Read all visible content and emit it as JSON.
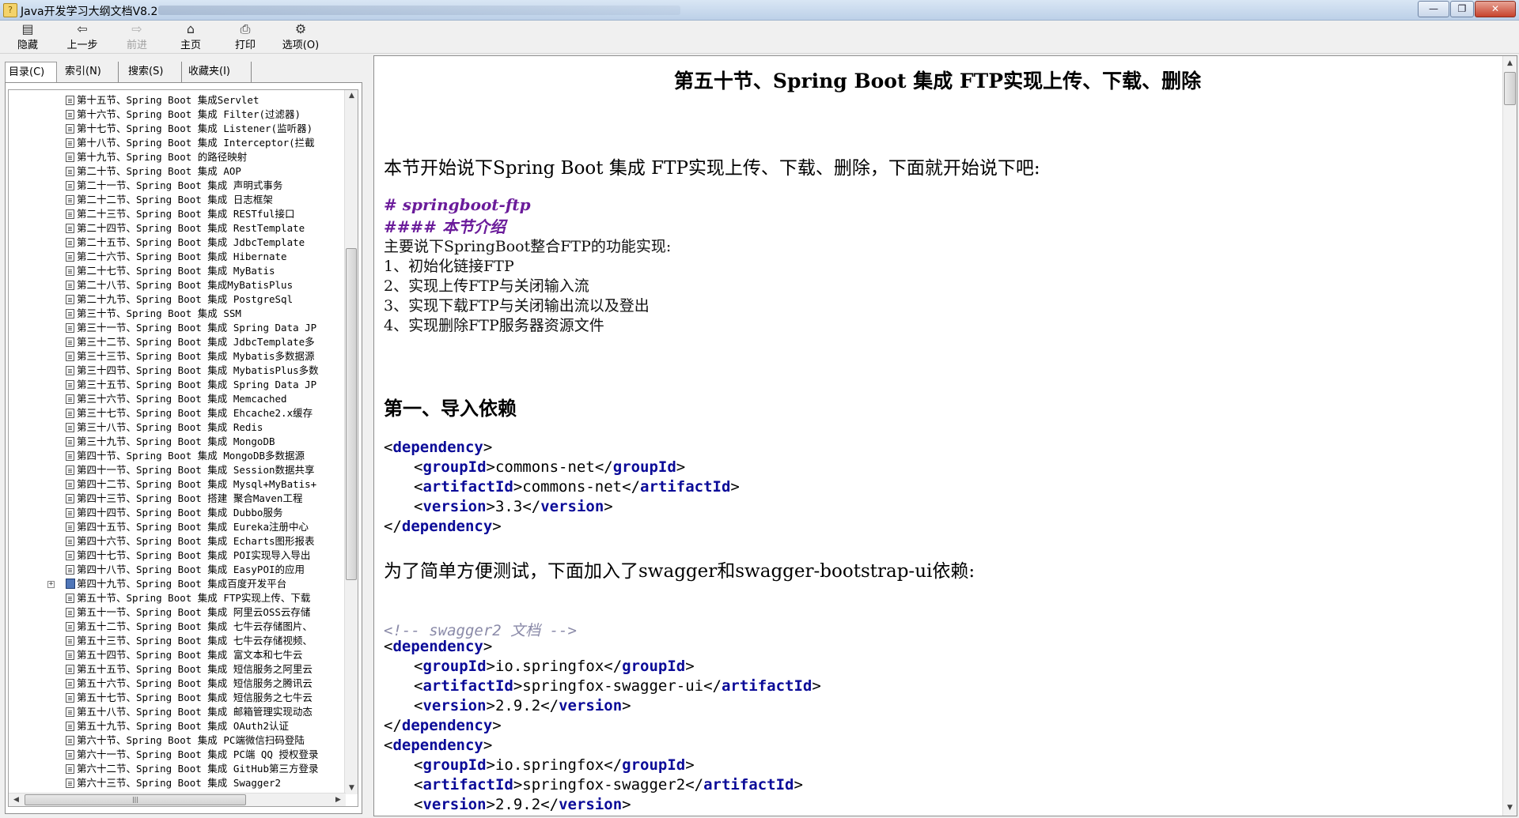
{
  "window": {
    "title": "Java开发学习大纲文档V8.2",
    "controls": [
      "minimize",
      "maximize",
      "close"
    ]
  },
  "toolbar": {
    "buttons": [
      {
        "label": "隐藏",
        "icon": "hide-icon",
        "enabled": true
      },
      {
        "label": "上一步",
        "icon": "back-arrow-icon",
        "enabled": true
      },
      {
        "label": "前进",
        "icon": "forward-arrow-icon",
        "enabled": false
      },
      {
        "label": "主页",
        "icon": "home-icon",
        "enabled": true
      },
      {
        "label": "打印",
        "icon": "printer-icon",
        "enabled": true
      },
      {
        "label": "选项(O)",
        "icon": "options-icon",
        "enabled": true
      }
    ]
  },
  "nav": {
    "tabs": [
      "目录(C)",
      "索引(N)",
      "搜索(S)",
      "收藏夹(I)"
    ],
    "active_tab": 0,
    "tree_items": [
      "第十五节、Spring Boot 集成Servlet",
      "第十六节、Spring Boot 集成 Filter(过滤器)",
      "第十七节、Spring Boot 集成 Listener(监听器)",
      "第十八节、Spring Boot 集成 Interceptor(拦截",
      "第十九节、Spring Boot 的路径映射",
      "第二十节、Spring Boot 集成 AOP",
      "第二十一节、Spring Boot 集成 声明式事务",
      "第二十二节、Spring Boot 集成 日志框架",
      "第二十三节、Spring Boot 集成 RESTful接口",
      "第二十四节、Spring Boot 集成 RestTemplate",
      "第二十五节、Spring Boot 集成 JdbcTemplate",
      "第二十六节、Spring Boot 集成 Hibernate",
      "第二十七节、Spring Boot 集成 MyBatis",
      "第二十八节、Spring Boot 集成MyBatisPlus",
      "第二十九节、Spring Boot 集成 PostgreSql",
      "第三十节、Spring Boot 集成 SSM",
      "第三十一节、Spring Boot 集成 Spring Data JP",
      "第三十二节、Spring Boot 集成 JdbcTemplate多",
      "第三十三节、Spring Boot 集成 Mybatis多数据源",
      "第三十四节、Spring Boot 集成 MybatisPlus多数",
      "第三十五节、Spring Boot 集成 Spring Data JP",
      "第三十六节、Spring Boot 集成 Memcached",
      "第三十七节、Spring Boot 集成 Ehcache2.x缓存",
      "第三十八节、Spring Boot 集成 Redis",
      "第三十九节、Spring Boot 集成 MongoDB",
      "第四十节、Spring Boot 集成 MongoDB多数据源",
      "第四十一节、Spring Boot 集成 Session数据共享",
      "第四十二节、Spring Boot 集成 Mysql+MyBatis+",
      "第四十三节、Spring Boot 搭建 聚合Maven工程",
      "第四十四节、Spring Boot 集成 Dubbo服务",
      "第四十五节、Spring Boot 集成 Eureka注册中心",
      "第四十六节、Spring Boot 集成 Echarts图形报表",
      "第四十七节、Spring Boot 集成 POI实现导入导出",
      "第四十八节、Spring Boot 集成 EasyPOI的应用",
      "第四十九节、Spring Boot 集成百度开发平台",
      "第五十节、Spring Boot 集成 FTP实现上传、下载",
      "第五十一节、Spring Boot 集成 阿里云OSS云存储",
      "第五十二节、Spring Boot 集成 七牛云存储图片、",
      "第五十三节、Spring Boot 集成 七牛云存储视频、",
      "第五十四节、Spring Boot 集成 富文本和七牛云",
      "第五十五节、Spring Boot 集成 短信服务之阿里云",
      "第五十六节、Spring Boot 集成 短信服务之腾讯云",
      "第五十七节、Spring Boot 集成 短信服务之七牛云",
      "第五十八节、Spring Boot 集成 邮箱管理实现动态",
      "第五十九节、Spring Boot 集成 OAuth2认证",
      "第六十节、Spring Boot 集成 PC端微信扫码登陆",
      "第六十一节、Spring Boot 集成 PC端 QQ 授权登录",
      "第六十二节、Spring Boot 集成 GitHub第三方登录",
      "第六十三节、Spring Boot 集成 Swagger2"
    ],
    "expandable_index": 34,
    "selected_index": 35
  },
  "article": {
    "title": "第五十节、Spring Boot 集成 FTP实现上传、下载、删除",
    "intro": "本节开始说下Spring Boot 集成 FTP实现上传、下载、删除，下面就开始说下吧:",
    "md_h1": "# springboot-ftp",
    "md_h4": "#### 本节介绍",
    "lead": "主要说下SpringBoot整合FTP的功能实现:",
    "steps": [
      "1、初始化链接FTP",
      "2、实现上传FTP与关闭输入流",
      "3、实现下载FTP与关闭输出流以及登出",
      "4、实现删除FTP服务器资源文件"
    ],
    "section1": "第一、导入依赖",
    "dep1": {
      "groupId": "commons-net",
      "artifactId": "commons-net",
      "version": "3.3"
    },
    "swagger_note": "为了简单方便测试，下面加入了swagger和swagger-bootstrap-ui依赖:",
    "comment": "<!-- swagger2 文档 -->",
    "dep2": {
      "groupId": "io.springfox",
      "artifactId": "springfox-swagger-ui",
      "version": "2.9.2"
    },
    "dep3": {
      "groupId": "io.springfox",
      "artifactId": "springfox-swagger2",
      "version": "2.9.2"
    },
    "tags": {
      "dependency": "dependency",
      "groupId": "groupId",
      "artifactId": "artifactId",
      "version": "version"
    }
  }
}
